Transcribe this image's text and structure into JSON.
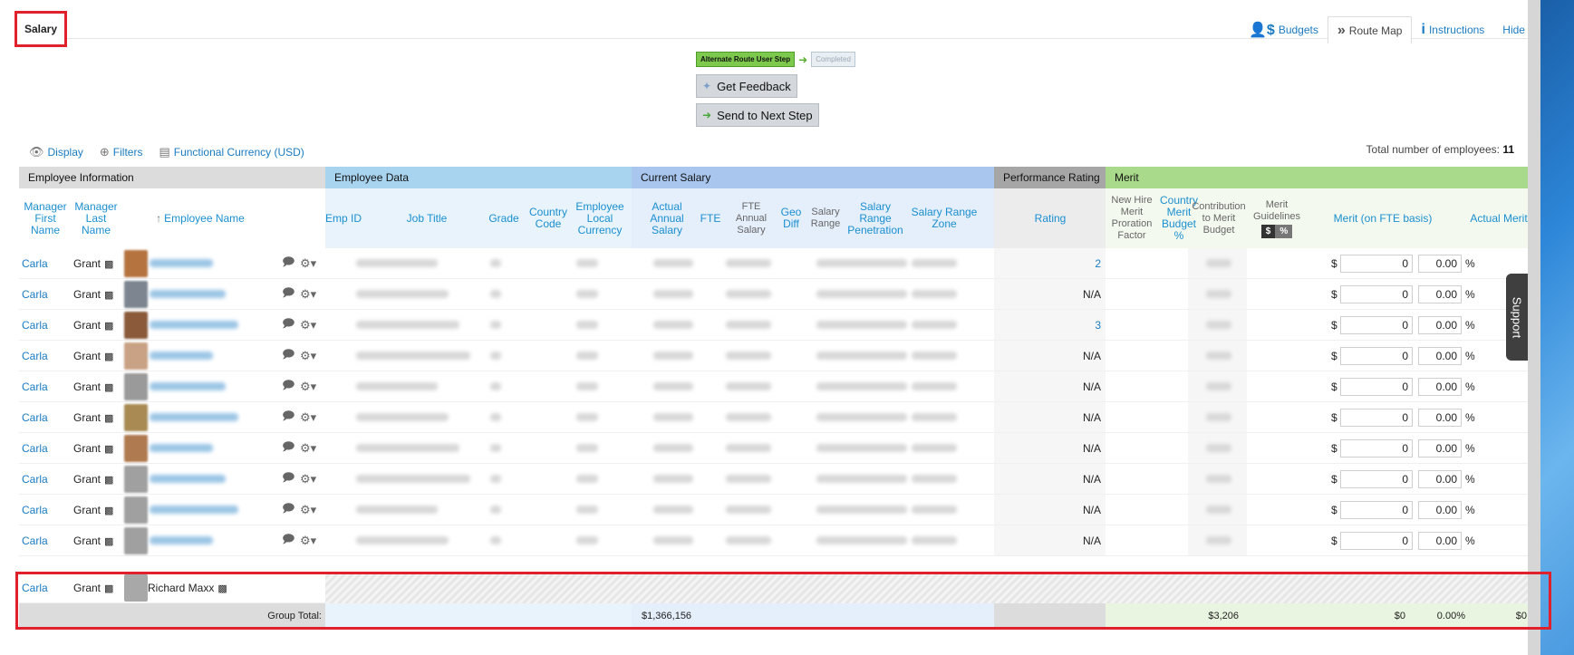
{
  "page": {
    "title": "Salary"
  },
  "topnav": [
    {
      "label": "Budgets",
      "icon": "budgets-icon",
      "glyph": "$",
      "active": false
    },
    {
      "label": "Route Map",
      "icon": "route-map-icon",
      "glyph": "»",
      "active": true
    },
    {
      "label": "Instructions",
      "icon": "info-icon",
      "glyph": "i",
      "active": false
    },
    {
      "label": "Hide",
      "icon": "",
      "glyph": "",
      "active": false
    }
  ],
  "route": {
    "step": "Alternate Route User Step",
    "done": "Completed"
  },
  "actions": {
    "feedback": "Get Feedback",
    "next": "Send to Next Step"
  },
  "toolbar": {
    "display": "Display",
    "filters": "Filters",
    "currency": "Functional Currency (USD)"
  },
  "total": {
    "label": "Total number of employees:",
    "value": "11"
  },
  "groups": {
    "employee_info": "Employee Information",
    "employee_data": "Employee Data",
    "current_salary": "Current Salary",
    "performance": "Performance Rating",
    "merit": "Merit"
  },
  "columns": {
    "mgr_first": "Manager First Name",
    "mgr_last": "Manager Last Name",
    "emp_name": "Employee Name",
    "emp_id": "Emp ID",
    "job_title": "Job Title",
    "grade": "Grade",
    "country": "Country Code",
    "local_currency": "Employee Local Currency",
    "actual_salary": "Actual Annual Salary",
    "fte": "FTE",
    "fte_salary": "FTE Annual Salary",
    "geo_diff": "Geo Diff",
    "salary_range": "Salary Range",
    "range_pen": "Salary Range Penetration",
    "range_zone": "Salary Range Zone",
    "rating": "Rating",
    "new_hire": "New Hire Merit Proration Factor",
    "country_budget": "Country Merit Budget %",
    "contribution": "Contribution to Merit Budget",
    "guidelines": "Merit Guidelines",
    "guide_dollar": "$",
    "guide_pct": "%",
    "merit_fte": "Merit (on FTE basis)",
    "actual_merit": "Actual Merit"
  },
  "rows": [
    {
      "mgr_first": "Carla",
      "mgr_last": "Grant",
      "rating": "2",
      "merit_amt": "0",
      "merit_pct": "0.00",
      "currency": "$",
      "pct_sign": "%",
      "avatar": "#b5733f"
    },
    {
      "mgr_first": "Carla",
      "mgr_last": "Grant",
      "rating": "N/A",
      "merit_amt": "0",
      "merit_pct": "0.00",
      "currency": "$",
      "pct_sign": "%",
      "avatar": "#7d8591"
    },
    {
      "mgr_first": "Carla",
      "mgr_last": "Grant",
      "rating": "3",
      "merit_amt": "0",
      "merit_pct": "0.00",
      "currency": "$",
      "pct_sign": "%",
      "avatar": "#8a5a3a"
    },
    {
      "mgr_first": "Carla",
      "mgr_last": "Grant",
      "rating": "N/A",
      "merit_amt": "0",
      "merit_pct": "0.00",
      "currency": "$",
      "pct_sign": "%",
      "avatar": "#c9a184"
    },
    {
      "mgr_first": "Carla",
      "mgr_last": "Grant",
      "rating": "N/A",
      "merit_amt": "0",
      "merit_pct": "0.00",
      "currency": "$",
      "pct_sign": "%",
      "avatar": "#9a9a9a"
    },
    {
      "mgr_first": "Carla",
      "mgr_last": "Grant",
      "rating": "N/A",
      "merit_amt": "0",
      "merit_pct": "0.00",
      "currency": "$",
      "pct_sign": "%",
      "avatar": "#a88a52"
    },
    {
      "mgr_first": "Carla",
      "mgr_last": "Grant",
      "rating": "N/A",
      "merit_amt": "0",
      "merit_pct": "0.00",
      "currency": "$",
      "pct_sign": "%",
      "avatar": "#b07a50"
    },
    {
      "mgr_first": "Carla",
      "mgr_last": "Grant",
      "rating": "N/A",
      "merit_amt": "0",
      "merit_pct": "0.00",
      "currency": "$",
      "pct_sign": "%",
      "avatar": "#a0a0a0"
    },
    {
      "mgr_first": "Carla",
      "mgr_last": "Grant",
      "rating": "N/A",
      "merit_amt": "0",
      "merit_pct": "0.00",
      "currency": "$",
      "pct_sign": "%",
      "avatar": "#a0a0a0"
    },
    {
      "mgr_first": "Carla",
      "mgr_last": "Grant",
      "rating": "N/A",
      "merit_amt": "0",
      "merit_pct": "0.00",
      "currency": "$",
      "pct_sign": "%",
      "avatar": "#a0a0a0"
    }
  ],
  "new_row": {
    "mgr_first": "Carla",
    "mgr_last": "Grant",
    "emp_name": "Richard Maxx"
  },
  "group_total": {
    "label": "Group Total:",
    "salary": "$1,366,156",
    "contribution": "$3,206",
    "merit_amt": "$0",
    "merit_pct": "0.00%",
    "actual": "$0"
  },
  "support": "Support",
  "colors": {
    "accent_link": "#1a7bc1",
    "employee_info_bg": "#dcdcdc",
    "employee_data_bg": "#a9d4f0",
    "current_salary_bg": "#a8c6ee",
    "performance_bg": "#a6a6a6",
    "merit_bg": "#a9d98a",
    "highlight_red": "#e0202b"
  }
}
